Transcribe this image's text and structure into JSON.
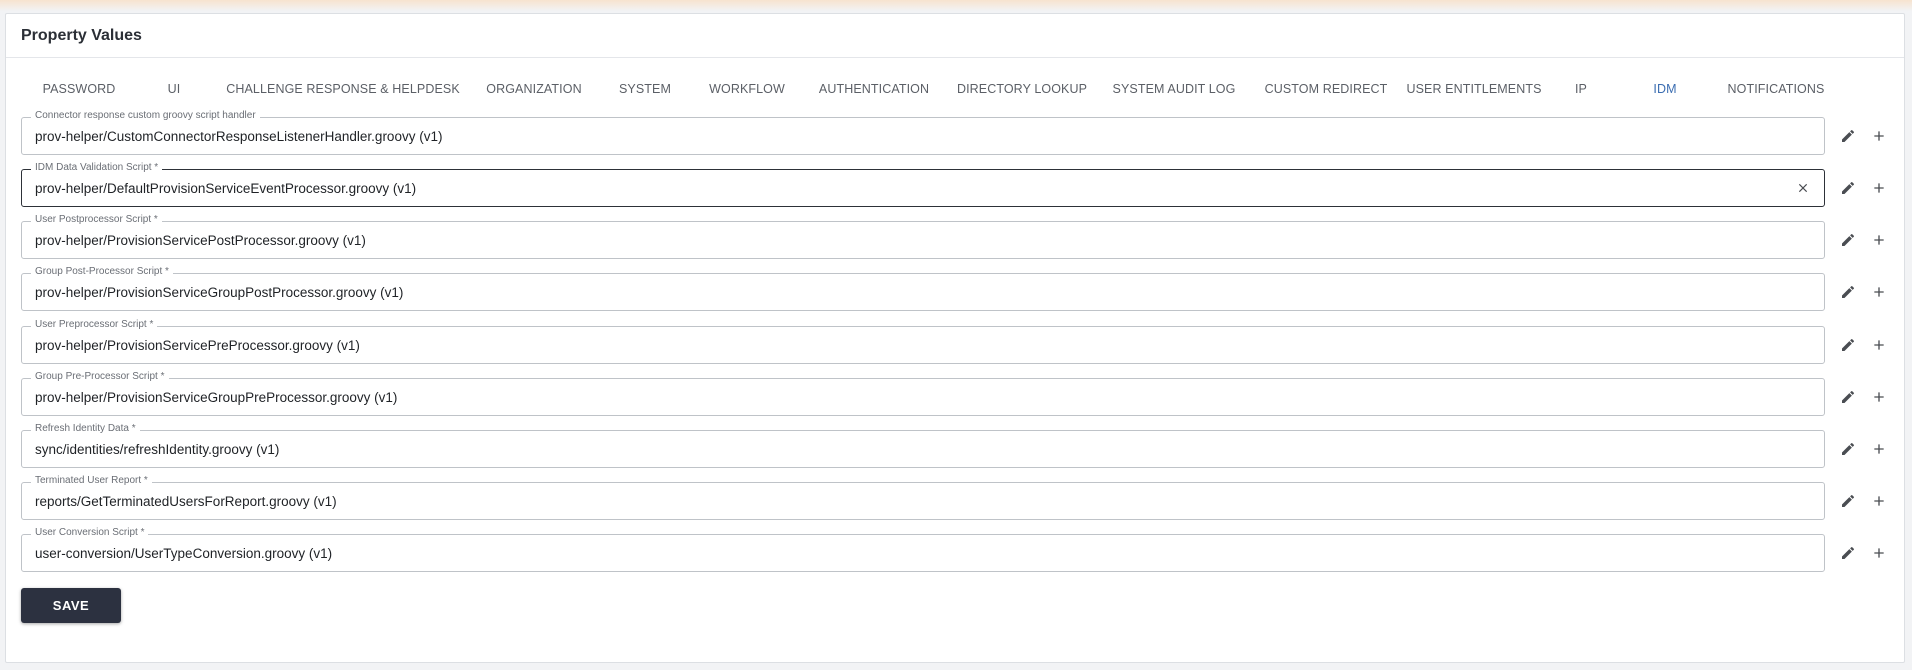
{
  "panel": {
    "title": "Property Values"
  },
  "tabs": [
    {
      "label": "PASSWORD",
      "active": false
    },
    {
      "label": "UI",
      "active": false
    },
    {
      "label": "CHALLENGE RESPONSE & HELPDESK",
      "active": false
    },
    {
      "label": "ORGANIZATION",
      "active": false
    },
    {
      "label": "SYSTEM",
      "active": false
    },
    {
      "label": "WORKFLOW",
      "active": false
    },
    {
      "label": "AUTHENTICATION",
      "active": false
    },
    {
      "label": "DIRECTORY LOOKUP",
      "active": false
    },
    {
      "label": "SYSTEM AUDIT LOG",
      "active": false
    },
    {
      "label": "CUSTOM REDIRECT",
      "active": false
    },
    {
      "label": "USER ENTITLEMENTS",
      "active": false
    },
    {
      "label": "IP",
      "active": false
    },
    {
      "label": "IDM",
      "active": true
    },
    {
      "label": "NOTIFICATIONS",
      "active": false
    }
  ],
  "fields": [
    {
      "label": "Connector response custom groovy script handler",
      "value": "prov-helper/CustomConnectorResponseListenerHandler.groovy (v1)"
    },
    {
      "label": "IDM Data Validation Script *",
      "value": "prov-helper/DefaultProvisionServiceEventProcessor.groovy (v1)",
      "focused": true
    },
    {
      "label": "User Postprocessor Script *",
      "value": "prov-helper/ProvisionServicePostProcessor.groovy (v1)"
    },
    {
      "label": "Group Post-Processor Script *",
      "value": "prov-helper/ProvisionServiceGroupPostProcessor.groovy (v1)"
    },
    {
      "label": "User Preprocessor Script *",
      "value": "prov-helper/ProvisionServicePreProcessor.groovy (v1)"
    },
    {
      "label": "Group Pre-Processor Script *",
      "value": "prov-helper/ProvisionServiceGroupPreProcessor.groovy (v1)"
    },
    {
      "label": "Refresh Identity Data *",
      "value": "sync/identities/refreshIdentity.groovy (v1)"
    },
    {
      "label": "Terminated User Report *",
      "value": "reports/GetTerminatedUsersForReport.groovy (v1)"
    },
    {
      "label": "User Conversion Script *",
      "value": "user-conversion/UserTypeConversion.groovy (v1)"
    }
  ],
  "icons": {
    "edit": "pencil-icon",
    "add": "plus-icon",
    "clear": "close-icon"
  },
  "save_button": {
    "label": "SAVE"
  },
  "colors": {
    "active_tab_text": "#3b6db1",
    "active_tab_indicator": "#e2813a",
    "save_button_bg": "#2c3140"
  }
}
